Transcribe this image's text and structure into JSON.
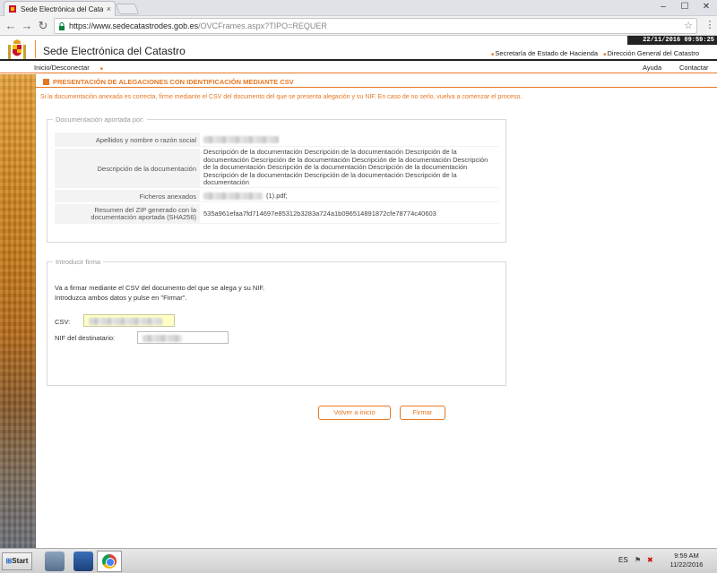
{
  "browser": {
    "tab_title": "Sede Electrónica del Catastro",
    "tab_close": "×",
    "url_host": "https://www.sedecatastrodes.gob.es",
    "url_path": "/OVCFrames.aspx?TIPO=REQUER",
    "back": "←",
    "forward": "→",
    "reload": "↻",
    "minimize": "–",
    "maximize": "☐",
    "close": "✕"
  },
  "header": {
    "datetime": "22/11/2016 09:59:25",
    "site_title": "Sede Electrónica del Catastro",
    "links": [
      "Secretaría de Estado de Hacienda",
      "Dirección General del Catastro"
    ]
  },
  "nav": {
    "home": "Inicio/Desconectar",
    "help": "Ayuda",
    "contact": "Contactar"
  },
  "main": {
    "title": "PRESENTACIÓN DE ALEGACIONES CON IDENTIFICACIÓN MEDIANTE CSV",
    "info": "Si la documentación anexada es correcta, firme mediante el CSV del documento del que se presenta alegación y su NIF. En caso de no serlo, vuelva a comenzar el proceso.",
    "docs_legend": "Documentación aportada por:",
    "rows": [
      {
        "label": "Apellidos y nombre o razón social",
        "value": ""
      },
      {
        "label": "Descripción de la documentación",
        "value": "Descripción de la documentación Descripción de la documentación Descripción de la documentación Descripción de la documentación Descripción de la documentación Descripción de la documentación Descripción de la documentación Descripción de la documentación Descripción de la documentación Descripción de la documentación Descripción de la documentación"
      },
      {
        "label": "Ficheros anexados",
        "value": "(1).pdf;"
      },
      {
        "label": "Resumen del ZIP generado con la documentación aportada (SHA256)",
        "value": "535a961efaa7fd714697e85312b3283a724a1b096514891872cfe78774c40603"
      }
    ],
    "sign_legend": "Introducir firma",
    "sign_text_1": "Va a firmar mediante el CSV del documento del que se alega y su NIF.",
    "sign_text_2": "Introduzca ambos datos y pulse en \"Firmar\".",
    "csv_label": "CSV:",
    "nif_label": "NIF del destinatario:",
    "btn_restart": "Volver a inicio",
    "btn_sign": "Firmar"
  },
  "taskbar": {
    "start": "Start",
    "lang": "ES",
    "time": "9:59 AM",
    "date": "11/22/2016"
  }
}
